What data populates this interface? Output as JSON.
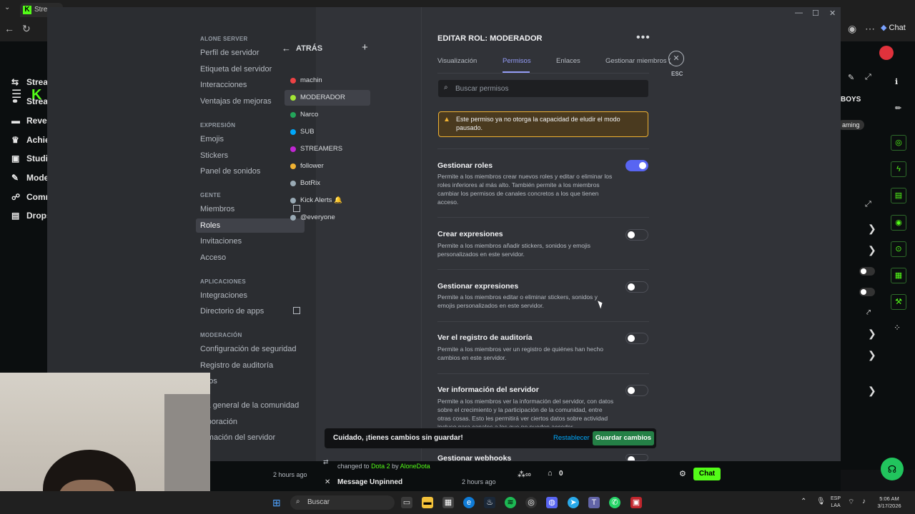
{
  "browser": {
    "tab_title": "Strea",
    "chat_label": "Chat"
  },
  "kick": {
    "logo": "K",
    "nav": [
      "Strea",
      "Strea",
      "Reve",
      "Achie",
      "Studi",
      "Mode",
      "Comr",
      "Drops"
    ],
    "right_text_boys": "BOYS",
    "right_text_gaming": "aming"
  },
  "window": {
    "minimize": "—",
    "maximize": "☐",
    "close": "✕"
  },
  "settings_sidebar": {
    "sections": [
      {
        "header": "ALONE SERVER",
        "items": [
          "Perfil de servidor",
          "Etiqueta del servidor",
          "Interacciones",
          "Ventajas de mejoras"
        ]
      },
      {
        "header": "EXPRESIÓN",
        "items": [
          "Emojis",
          "Stickers",
          "Panel de sonidos"
        ]
      },
      {
        "header": "GENTE",
        "items": [
          "Miembros",
          "Roles",
          "Invitaciones",
          "Acceso"
        ]
      },
      {
        "header": "APLICACIONES",
        "items": [
          "Integraciones",
          "Directorio de apps"
        ]
      },
      {
        "header": "MODERACIÓN",
        "items": [
          "Configuración de seguridad",
          "Registro de auditoría",
          "neos"
        ]
      },
      {
        "header": "",
        "items": [
          "sta general de la comunidad",
          "orporación",
          "ormación del servidor"
        ]
      }
    ]
  },
  "roles_panel": {
    "back_label": "ATRÁS",
    "add_icon": "+",
    "roles": [
      {
        "name": "machin",
        "color": "#ed4245"
      },
      {
        "name": "MODERADOR",
        "color": "#a3e635"
      },
      {
        "name": "Narco",
        "color": "#23a55a"
      },
      {
        "name": "SUB",
        "color": "#00a8fc"
      },
      {
        "name": "STREAMERS",
        "color": "#c026d3"
      },
      {
        "name": "follower",
        "color": "#f0b232"
      },
      {
        "name": "BotRix",
        "color": "#99aab5"
      },
      {
        "name": "Kick Alerts 🔔",
        "color": "#99aab5"
      },
      {
        "name": "@everyone",
        "color": "#99aab5"
      }
    ]
  },
  "editor": {
    "title": "EDITAR ROL: MODERADOR",
    "more_icon": "•••",
    "tabs": [
      "Visualización",
      "Permisos",
      "Enlaces",
      "Gestionar miembros (2)"
    ],
    "active_tab": "Permisos",
    "close_label": "ESC",
    "search_placeholder": "Buscar permisos",
    "warning": "Este permiso ya no otorga la capacidad de eludir el modo pausado.",
    "permissions": [
      {
        "title": "Gestionar roles",
        "desc": "Permite a los miembros crear nuevos roles y editar o eliminar los roles inferiores al más alto. También permite a los miembros cambiar los permisos de canales concretos a los que tienen acceso.",
        "enabled": true
      },
      {
        "title": "Crear expresiones",
        "desc": "Permite a los miembros añadir stickers, sonidos y emojis personalizados en este servidor.",
        "enabled": false
      },
      {
        "title": "Gestionar expresiones",
        "desc": "Permite a los miembros editar o eliminar stickers, sonidos y emojis personalizados en este servidor.",
        "enabled": false
      },
      {
        "title": "Ver el registro de auditoría",
        "desc": "Permite a los miembros ver un registro de quiénes han hecho cambios en este servidor.",
        "enabled": false
      },
      {
        "title": "Ver información del servidor",
        "desc": "Permite a los miembros ver la información del servidor, con datos sobre el crecimiento y la participación de la comunidad, entre otras cosas. Esto les permitirá ver ciertos datos sobre actividad incluso para canales a los que no pueden acceder.",
        "enabled": false
      },
      {
        "title": "Gestionar webhooks",
        "desc": "",
        "enabled": false
      }
    ]
  },
  "unsaved_bar": {
    "message": "Cuidado, ¡tienes cambios sin guardar!",
    "reset": "Restablecer",
    "save": "Guardar cambios"
  },
  "stream_bottom": {
    "time1": "2 hours ago",
    "changed_prefix": "changed to",
    "changed_game": "Dota 2",
    "changed_by": "by",
    "changed_user": "AloneDota",
    "unpinned": "Message Unpinned",
    "time2": "2 hours ago",
    "zero_count": "0",
    "chat_button": "Chat"
  },
  "taskbar": {
    "search_placeholder": "Buscar",
    "lang_top": "ESP",
    "lang_bottom": "LAA",
    "time": "5:06 AM",
    "date": "3/17/2026"
  }
}
